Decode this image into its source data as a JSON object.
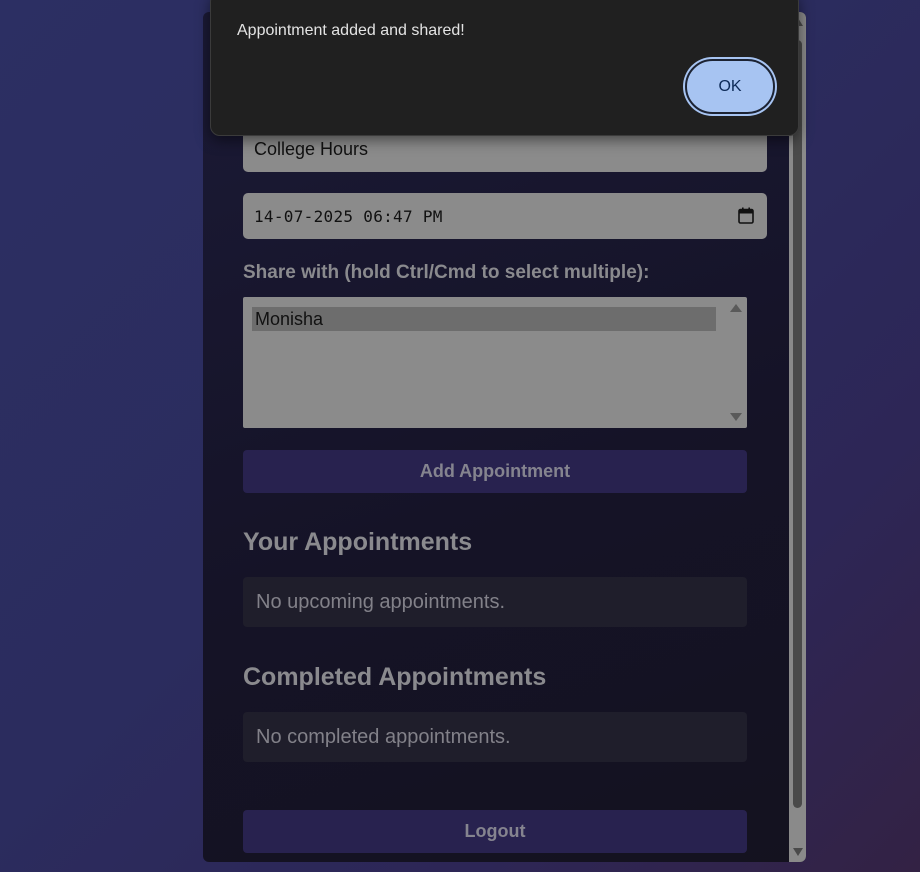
{
  "form": {
    "title_value": "College Hours",
    "datetime_value": "14-07-2025 06:47 PM",
    "share_label": "Share with (hold Ctrl/Cmd to select multiple):",
    "share_options": [
      "Monisha"
    ],
    "add_button_label": "Add Appointment"
  },
  "your_appointments": {
    "heading": "Your Appointments",
    "empty_message": "No upcoming appointments."
  },
  "completed_appointments": {
    "heading": "Completed Appointments",
    "empty_message": "No completed appointments."
  },
  "logout_label": "Logout",
  "dialog": {
    "title": "",
    "message": "Appointment added and shared!",
    "ok_label": "OK"
  },
  "icons": {
    "calendar": "calendar-icon",
    "scroll_up": "triangle-up-icon",
    "scroll_down": "triangle-down-icon"
  },
  "colors": {
    "background": "#2c2f63",
    "panel": "#161429",
    "button": "#28224f",
    "dialog": "#202020",
    "ok_button": "#a7c4f2"
  }
}
